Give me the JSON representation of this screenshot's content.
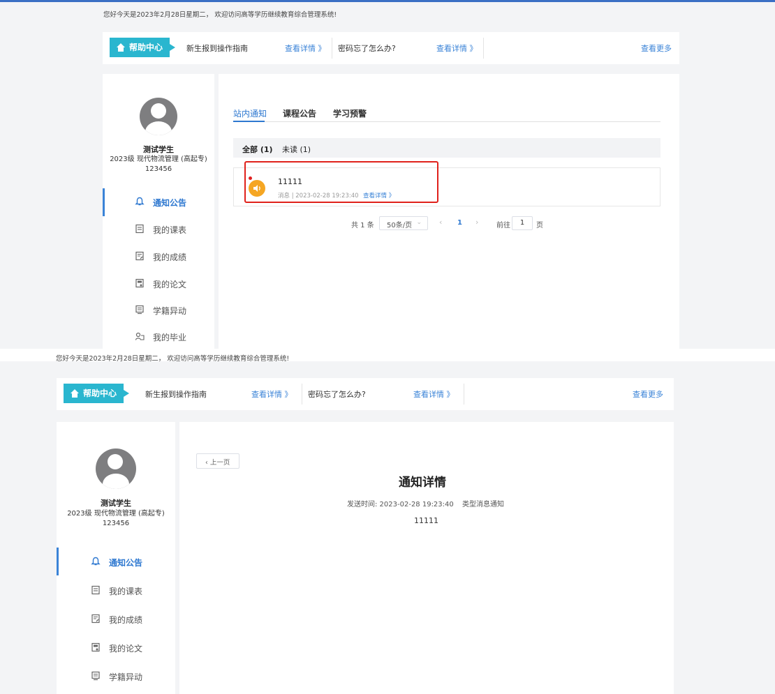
{
  "greeting": "您好今天是2023年2月28日星期二， 欢迎访问高等学历继续教育综合管理系统!",
  "help": {
    "title": "帮助中心",
    "items": [
      {
        "text": "新生报到操作指南",
        "link": "查看详情 》"
      },
      {
        "text": "密码忘了怎么办?",
        "link": "查看详情 》"
      }
    ],
    "more": "查看更多"
  },
  "user": {
    "name": "测试学生",
    "program": "2023级 现代物流管理 (高起专)",
    "id": "123456"
  },
  "menu": {
    "items": [
      {
        "label": "通知公告",
        "icon": "bell-icon"
      },
      {
        "label": "我的课表",
        "icon": "schedule-icon"
      },
      {
        "label": "我的成绩",
        "icon": "grades-icon"
      },
      {
        "label": "我的论文",
        "icon": "thesis-icon"
      },
      {
        "label": "学籍异动",
        "icon": "status-change-icon"
      },
      {
        "label": "我的毕业",
        "icon": "graduation-icon"
      }
    ]
  },
  "notices": {
    "tabs": [
      "站内通知",
      "课程公告",
      "学习预警"
    ],
    "filters": {
      "all": "全部",
      "all_count": "(1)",
      "unread": "未读",
      "unread_count": "(1)"
    },
    "message": {
      "title": "11111",
      "meta": "消息 | 2023-02-28 19:23:40",
      "link": "查看详情 》"
    },
    "pager": {
      "total": "共 1 条",
      "page_size": "50条/页",
      "current": "1",
      "goto_label": "前往",
      "goto_value": "1",
      "page_suffix": "页"
    }
  },
  "detail": {
    "back": "上一页",
    "title": "通知详情",
    "send_time": "发送时间: 2023-02-28 19:23:40",
    "type": "类型消息通知",
    "body": "11111"
  },
  "colors": {
    "accent": "#2e78d0",
    "help_tag": "#2ab6cf",
    "highlight": "#e0211b",
    "speaker": "#f5a623"
  }
}
